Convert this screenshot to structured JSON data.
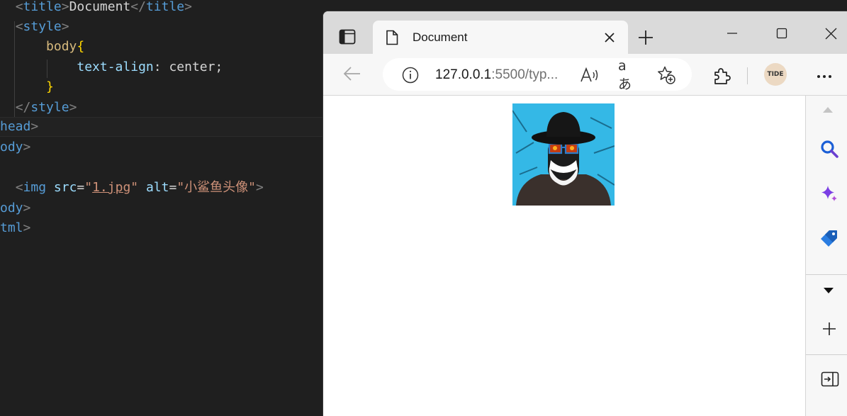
{
  "editor": {
    "lines": {
      "l1": {
        "indent": "  ",
        "open": "<",
        "tag": "title",
        "close": ">",
        "text": "Document",
        "end_open": "</",
        "end_tag": "title",
        "end_close": ">"
      },
      "l2": {
        "indent": "  ",
        "open": "<",
        "tag": "style",
        "close": ">"
      },
      "l3": {
        "indent": "      ",
        "selector": "body",
        "brace": "{"
      },
      "l4": {
        "indent": "          ",
        "property": "text-align",
        "colon": ": ",
        "value": "center;"
      },
      "l5": {
        "indent": "      ",
        "brace": "}"
      },
      "l6": {
        "indent": "  ",
        "open": "</",
        "tag": "style",
        "close": ">"
      },
      "l7": {
        "tag": "head",
        "close": ">"
      },
      "l8": {
        "tag": "ody",
        "close": ">"
      },
      "l9": {
        "indent": "  ",
        "open": "<",
        "tag": "img",
        "space1": " ",
        "attr1": "src",
        "eq1": "=",
        "q": "\"",
        "val1": "1.jpg",
        "space2": " ",
        "attr2": "alt",
        "eq2": "=",
        "val2": "小鲨鱼头像",
        "close": ">"
      },
      "l10": {
        "tag": "ody",
        "close": ">"
      },
      "l11": {
        "tag": "tml",
        "close": ">"
      }
    }
  },
  "browser": {
    "tab_title": "Document",
    "url_host": "127.0.0.1",
    "url_rest": ":5500/typ...",
    "read_aloud": "A))",
    "translate": "aあ",
    "profile_text": "TIDE",
    "page_image_alt": "小鲨鱼头像"
  },
  "colors": {
    "editor_bg": "#1f1f1f",
    "tag": "#569cd6",
    "attribute": "#9cdcfe",
    "string": "#ce9178",
    "selector": "#d7ba7d",
    "brace": "#ffd700",
    "browser_chrome": "#f7f7f7",
    "tabstrip": "#dadada"
  },
  "icons": {
    "tab_actions": "tab-actions-icon",
    "tab_page": "page-icon",
    "tab_close": "close-icon",
    "new_tab": "plus-icon",
    "minimize": "minimize-icon",
    "maximize": "maximize-icon",
    "close_window": "close-icon",
    "back": "back-arrow-icon",
    "site_info": "info-icon",
    "favorite": "star-plus-icon",
    "extensions": "puzzle-icon",
    "more": "more-dots-icon",
    "sidebar_search": "search-icon",
    "sidebar_copilot": "sparkle-icon",
    "sidebar_shopping": "tag-icon",
    "sidebar_collapse": "caret-down-icon",
    "sidebar_add": "plus-icon",
    "sidebar_panel": "panel-icon"
  }
}
